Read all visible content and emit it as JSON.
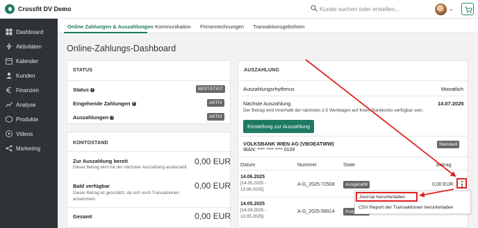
{
  "app": {
    "name": "Crossfit DV Demo"
  },
  "search": {
    "placeholder": "Kunde suchen oder erstellen..."
  },
  "sidebar": {
    "items": [
      {
        "label": "Dashboard",
        "icon": "grid-icon"
      },
      {
        "label": "Aktivitäten",
        "icon": "activity-icon"
      },
      {
        "label": "Kalender",
        "icon": "calendar-icon"
      },
      {
        "label": "Kunden",
        "icon": "user-icon"
      },
      {
        "label": "Finanzen",
        "icon": "euro-icon"
      },
      {
        "label": "Analyse",
        "icon": "chart-icon"
      },
      {
        "label": "Produkte",
        "icon": "box-icon"
      },
      {
        "label": "Videos",
        "icon": "play-icon"
      },
      {
        "label": "Marketing",
        "icon": "share-icon"
      }
    ]
  },
  "tabs": [
    {
      "label": "Online Zahlungen & Auszahlungen",
      "active": true
    },
    {
      "label": "Kommunikation"
    },
    {
      "label": "Firmenrechnungen"
    },
    {
      "label": "Transaktionsgebühren"
    }
  ],
  "page": {
    "title": "Online-Zahlungs-Dashboard"
  },
  "status": {
    "title": "STATUS",
    "rows": [
      {
        "label": "Status",
        "badge": "BESTÄTIGT"
      },
      {
        "label": "Eingehende Zahlungen",
        "badge": "AKTIV"
      },
      {
        "label": "Auszahlungen",
        "badge": "AKTIV"
      }
    ]
  },
  "kontostand": {
    "title": "KONTOSTAND",
    "ready": {
      "label": "Zur Auszahlung bereit",
      "desc": "Dieser Betrag wird mit der nächsten Auszahlung ausbezahlt",
      "amount": "0,00 EUR"
    },
    "soon": {
      "label": "Bald verfügbar",
      "desc1": "Dieser Betrag ist geschätzt, da sich noch Transaktionen",
      "desc2": "ansammeln",
      "amount": "0,00 EUR"
    },
    "total": {
      "label": "Gesamt",
      "amount": "0,00 EUR"
    }
  },
  "auszahlung": {
    "title": "AUSZAHLUNG",
    "rhythm_label": "Auszahlungsrhythmus",
    "rhythm_value": "Monatlich",
    "next_label": "Nächste Auszahlung",
    "next_date": "14.07.2025",
    "next_desc": "Der Betrag wird innerhalb der nächsten 2-5 Werktagen auf Ihrem Bankkonto verfügbar sein.",
    "settings_button": "Einstellung zur Auszahlung",
    "bank_name": "VOLKSBANK WIEN AG (VBOEATWW)",
    "iban": "IBAN: **** **** **** 0109",
    "bank_badge": "Standard",
    "table": {
      "headers": [
        "Datum",
        "Nummer",
        "State",
        "Betrag"
      ],
      "rows": [
        {
          "date": "14.06.2025",
          "range1": "[14.05.2025 -",
          "range2": "13.06.2025]",
          "number": "A-G_2025-72508",
          "state": "Ausgezahlt",
          "amount": "0,00 EUR"
        },
        {
          "date": "14.05.2025",
          "range1": "[14.04.2025 -",
          "range2": "13.05.2025]",
          "number": "A-G_2025-58914",
          "state": "Ausgezahlt",
          "amount": ""
        }
      ]
    }
  },
  "menu": {
    "items": [
      "Journal herunterladen",
      "CSV Report der Transaktionen herunterladen"
    ]
  },
  "colors": {
    "brand": "#1f7a64",
    "sidebar": "#2f3236",
    "annotation": "#e02020"
  }
}
